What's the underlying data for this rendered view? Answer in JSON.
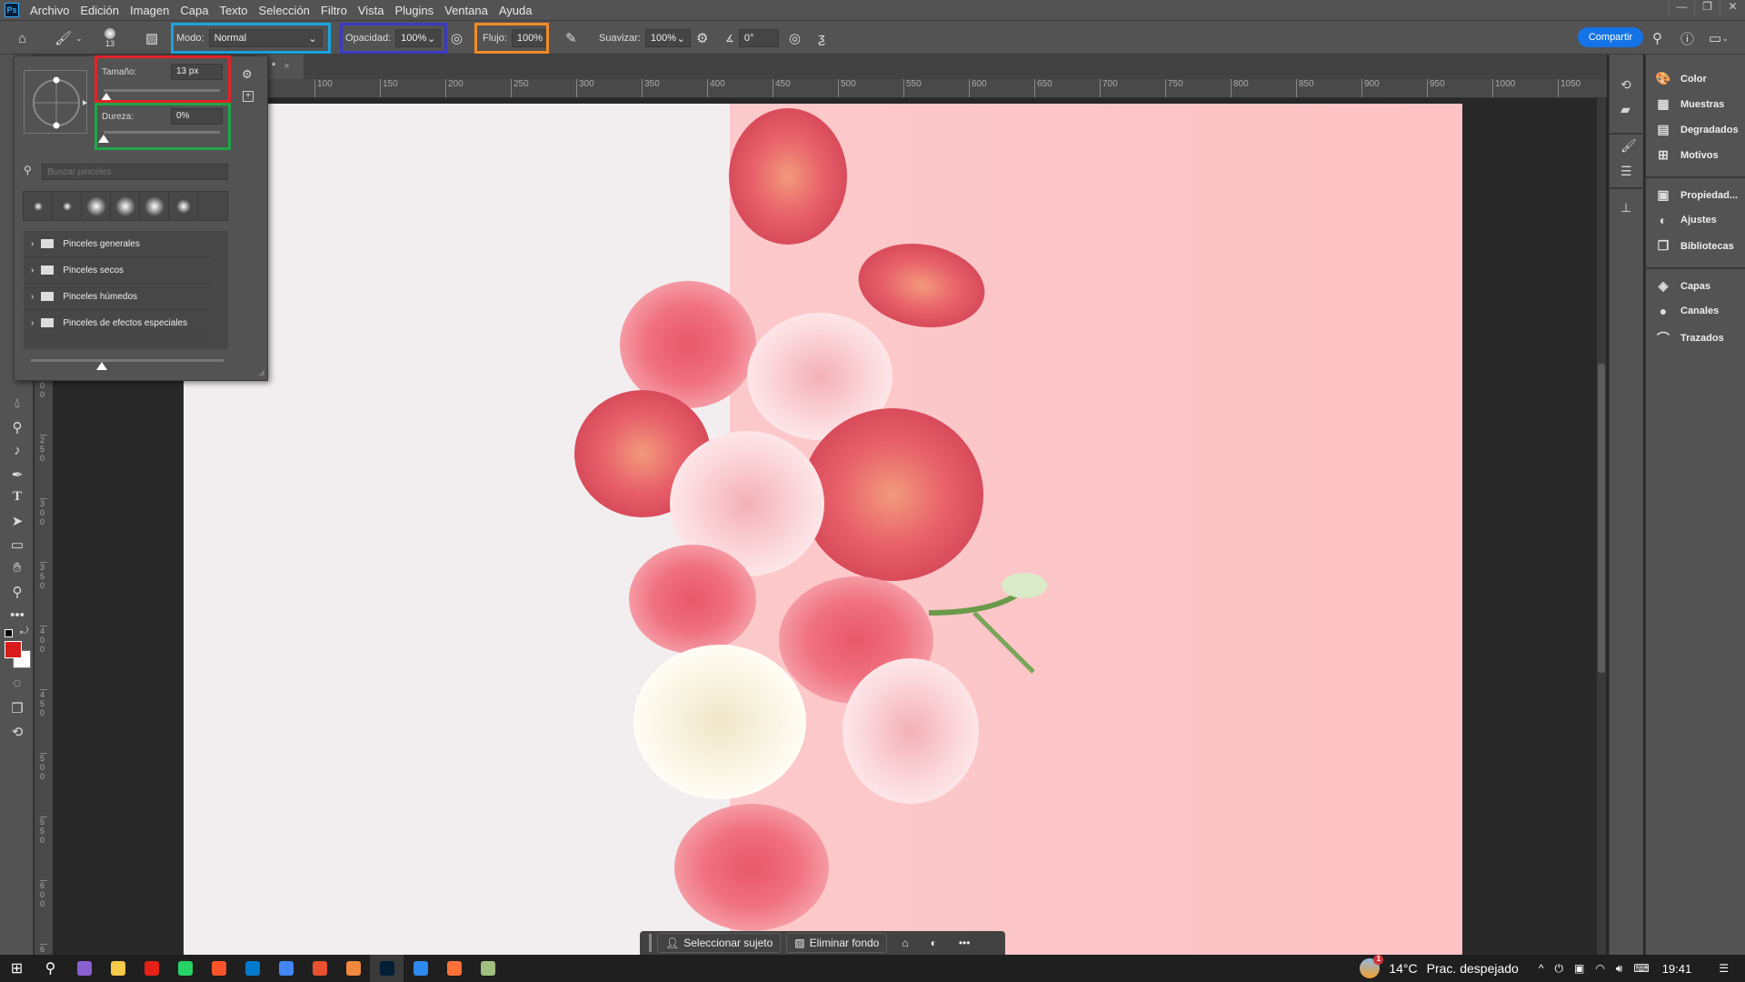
{
  "app": {
    "logo": "Ps",
    "menu": [
      "Archivo",
      "Edición",
      "Imagen",
      "Capa",
      "Texto",
      "Selección",
      "Filtro",
      "Vista",
      "Plugins",
      "Ventana",
      "Ayuda"
    ],
    "window_buttons": [
      "—",
      "❐",
      "✕"
    ]
  },
  "options": {
    "brush_size_preview": "13",
    "mode_label": "Modo:",
    "mode_value": "Normal",
    "opacity_label": "Opacidad:",
    "opacity_value": "100%",
    "flow_label": "Flujo:",
    "flow_value": "100%",
    "smoothing_label": "Suavizar:",
    "smoothing_value": "100%",
    "angle_value": "0°",
    "share_label": "Compartir"
  },
  "highlight_colors": {
    "mode": "#1aa3e0",
    "opacity": "#3b3bc4",
    "flow": "#f28c28",
    "size": "#e32228",
    "hardness": "#1fa64a"
  },
  "document_tab": {
    "title": "3) *",
    "close": "×"
  },
  "ruler": {
    "horizontal": [
      "100",
      "150",
      "200",
      "250",
      "300",
      "350",
      "400",
      "450",
      "500",
      "550",
      "600",
      "650",
      "700",
      "750",
      "800",
      "850",
      "900",
      "950",
      "1000",
      "1050"
    ],
    "vertical": [
      "200",
      "250",
      "300",
      "350",
      "400",
      "450",
      "500",
      "550",
      "600",
      "650"
    ]
  },
  "brush_panel": {
    "size_label": "Tamaño:",
    "size_value": "13 px",
    "size_slider_percent": 2,
    "hardness_label": "Dureza:",
    "hardness_value": "0%",
    "hardness_slider_percent": 0,
    "search_placeholder": "Buscar pinceles",
    "folders": [
      "Pinceles generales",
      "Pinceles secos",
      "Pinceles húmedos",
      "Pinceles de efectos especiales"
    ],
    "preview_slider_percent": 37
  },
  "right_panel": {
    "groups": [
      [
        {
          "icon": "palette-icon",
          "glyph": "🎨",
          "label": "Color"
        },
        {
          "icon": "swatches-icon",
          "glyph": "▦",
          "label": "Muestras"
        },
        {
          "icon": "gradient-icon",
          "glyph": "▤",
          "label": "Degradados"
        },
        {
          "icon": "patterns-icon",
          "glyph": "⊞",
          "label": "Motivos"
        }
      ],
      [
        {
          "icon": "properties-icon",
          "glyph": "▣",
          "label": "Propiedad..."
        },
        {
          "icon": "adjustments-icon",
          "glyph": "◐",
          "label": "Ajustes"
        },
        {
          "icon": "libraries-icon",
          "glyph": "❐",
          "label": "Bibliotecas"
        }
      ],
      [
        {
          "icon": "layers-icon",
          "glyph": "◈",
          "label": "Capas"
        },
        {
          "icon": "channels-icon",
          "glyph": "●",
          "label": "Canales"
        },
        {
          "icon": "paths-icon",
          "glyph": "⌒",
          "label": "Trazados"
        }
      ]
    ]
  },
  "context_bar": {
    "select_subject": "Seleccionar sujeto",
    "remove_background": "Eliminar fondo"
  },
  "taskbar": {
    "apps": [
      {
        "name": "whatsapp",
        "color": "#25d366"
      },
      {
        "name": "brave",
        "color": "#fb542b"
      },
      {
        "name": "vscode",
        "color": "#007acc"
      },
      {
        "name": "chrome",
        "color": "#4285f4"
      },
      {
        "name": "brave-alt",
        "color": "#e8502f"
      },
      {
        "name": "app-orange",
        "color": "#f0883e"
      },
      {
        "name": "photoshop",
        "color": "#001e36"
      },
      {
        "name": "camera",
        "color": "#2d89ef"
      },
      {
        "name": "firefox",
        "color": "#ff7139"
      },
      {
        "name": "app-misc",
        "color": "#a0c080"
      }
    ],
    "weather": "14°C",
    "weather_desc": "Prac. despejado",
    "weather_badge": "1",
    "time": "19:41"
  }
}
